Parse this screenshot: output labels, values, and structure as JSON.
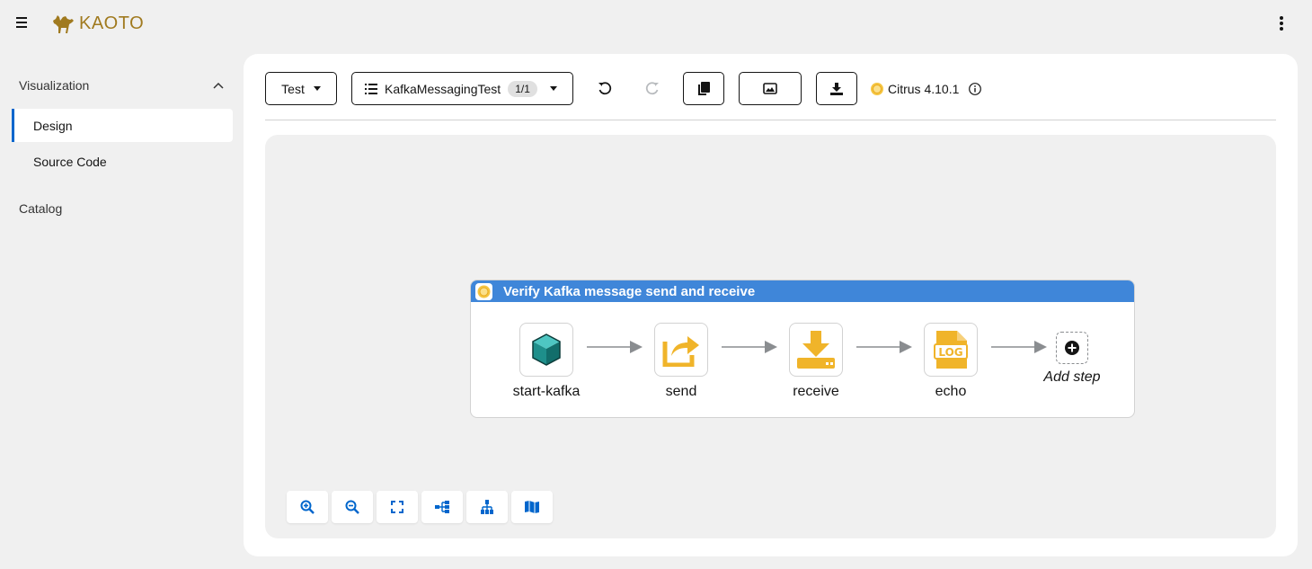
{
  "masthead": {
    "brand": "KAOTO",
    "menu_icon": "hamburger-icon",
    "options_icon": "kebab-icon"
  },
  "sidebar": {
    "section_label": "Visualization",
    "items": [
      {
        "label": "Design",
        "active": true
      },
      {
        "label": "Source Code",
        "active": false
      }
    ],
    "catalog_label": "Catalog"
  },
  "toolbar": {
    "type_select": "Test",
    "flow_select": "KafkaMessagingTest",
    "flow_count": "1/1",
    "runtime": "Citrus 4.10.1",
    "icons": [
      "undo-icon",
      "redo-icon",
      "copy-icon",
      "image-export-icon",
      "download-icon",
      "info-icon"
    ]
  },
  "route": {
    "title": "Verify Kafka message send and receive",
    "steps": [
      {
        "label": "start-kafka",
        "icon": "cube-icon"
      },
      {
        "label": "send",
        "icon": "share-icon"
      },
      {
        "label": "receive",
        "icon": "download-icon"
      },
      {
        "label": "echo",
        "icon": "log-icon"
      }
    ],
    "add_step_label": "Add step"
  },
  "canvas_controls": [
    "zoom-in-icon",
    "zoom-out-icon",
    "fit-view-icon",
    "horizontal-layout-icon",
    "vertical-layout-icon",
    "legend-icon"
  ],
  "colors": {
    "accent": "#0066cc",
    "route_header": "#3f86d9",
    "step_icon": "#f0b42a",
    "brand": "#a07a1f"
  }
}
